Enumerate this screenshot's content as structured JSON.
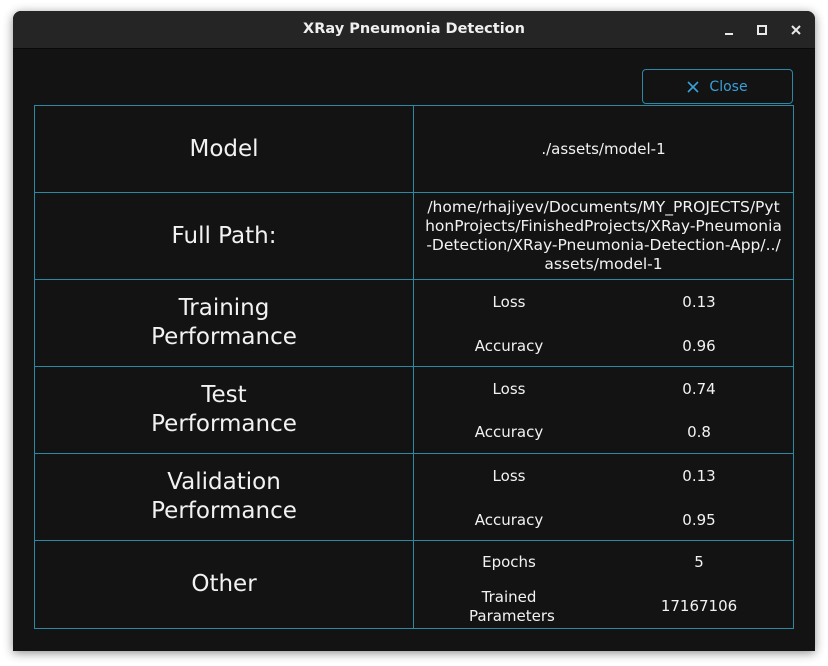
{
  "window": {
    "title": "XRay Pneumonia Detection"
  },
  "actions": {
    "close_label": "Close"
  },
  "table": {
    "model": {
      "label": "Model",
      "value": "./assets/model-1"
    },
    "full_path": {
      "label": "Full Path:",
      "value": "/home/rhajiyev/Documents/MY_PROJECTS/PythonProjects/FinishedProjects/XRay-Pneumonia-Detection/XRay-Pneumonia-Detection-App/../assets/model-1"
    },
    "training": {
      "label": "Training Performance",
      "loss_label": "Loss",
      "loss": "0.13",
      "accuracy_label": "Accuracy",
      "accuracy": "0.96"
    },
    "test": {
      "label": "Test Performance",
      "loss_label": "Loss",
      "loss": "0.74",
      "accuracy_label": "Accuracy",
      "accuracy": "0.8"
    },
    "validation": {
      "label": "Validation Performance",
      "loss_label": "Loss",
      "loss": "0.13",
      "accuracy_label": "Accuracy",
      "accuracy": "0.95"
    },
    "other": {
      "label": "Other",
      "epochs_label": "Epochs",
      "epochs": "5",
      "params_label": "Trained Parameters",
      "params": "17167106"
    }
  },
  "colors": {
    "background": "#131313",
    "titlebar": "#252525",
    "grid_border": "#2a8aa3",
    "accent": "#3a9fd8",
    "text": "#f2f2f2"
  },
  "icons": {
    "close_button_icon": "close-x-icon",
    "window_minimize": "minimize-icon",
    "window_maximize": "maximize-icon",
    "window_close": "window-close-icon"
  }
}
